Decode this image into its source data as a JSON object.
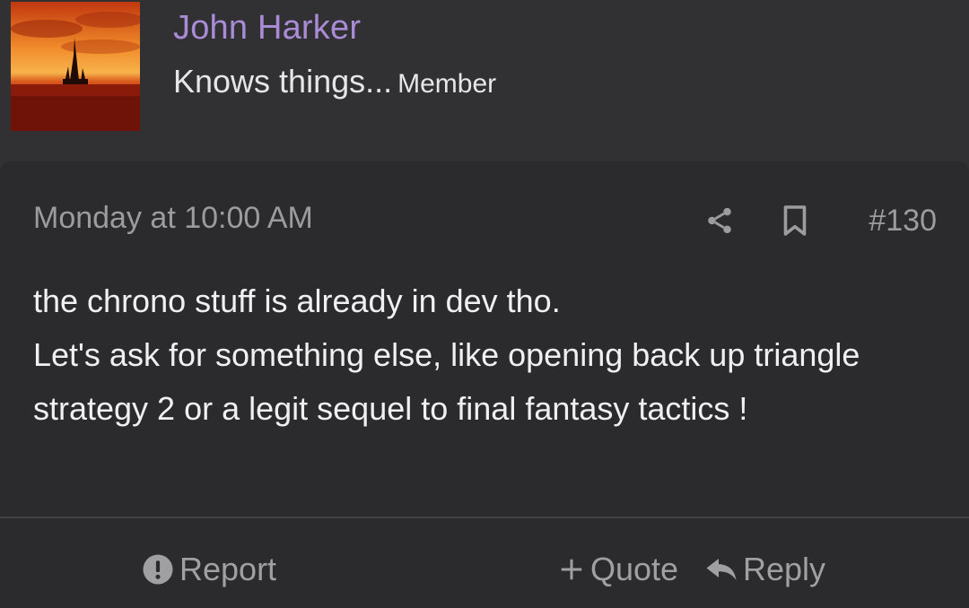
{
  "author": {
    "name": "John Harker",
    "title": "Knows things...",
    "role": "Member",
    "name_color": "#a98bd6",
    "avatar_icon": "castle-sunset-avatar"
  },
  "post": {
    "date": "Monday at 10:00 AM",
    "number": "#130",
    "share_icon": "share-icon",
    "bookmark_icon": "bookmark-icon",
    "body_lines": [
      "the chrono stuff is already in dev tho.",
      "Let's ask for something else, like opening back up triangle strategy 2 or a legit sequel to final fantasy tactics !"
    ]
  },
  "footer": {
    "report_label": "Report",
    "quote_label": "Quote",
    "reply_label": "Reply",
    "report_icon": "alert-circle-icon",
    "quote_icon": "plus-icon",
    "reply_icon": "reply-arrow-icon"
  }
}
